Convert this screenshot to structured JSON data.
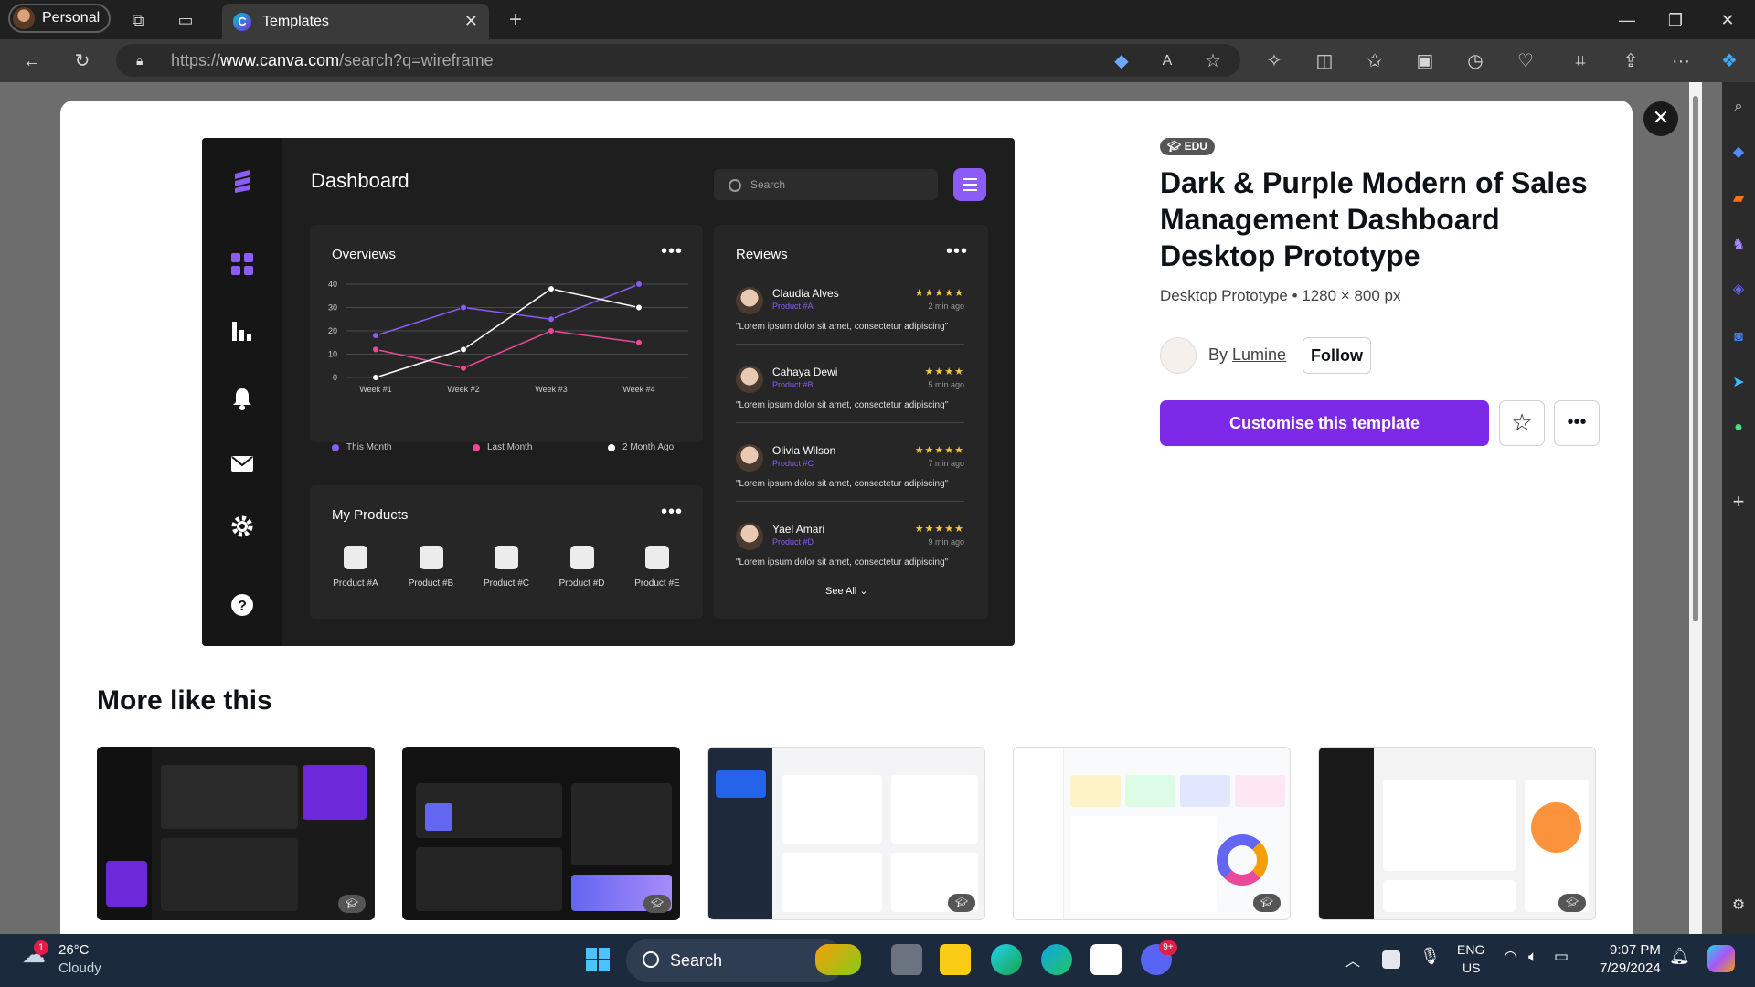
{
  "browser": {
    "profile_label": "Personal",
    "tab_title": "Templates",
    "url_prefix": "https://",
    "url_host": "www.canva.com",
    "url_path": "/search?q=wireframe"
  },
  "template": {
    "badge": "EDU",
    "title": "Dark & Purple Modern of Sales Management Dashboard Desktop Prototype",
    "subtitle": "Desktop Prototype • 1280 × 800 px",
    "by_prefix": "By",
    "creator": "Lumine",
    "follow_label": "Follow",
    "customise_label": "Customise this template",
    "more_heading": "More like this"
  },
  "preview": {
    "title": "Dashboard",
    "search_placeholder": "Search",
    "overviews": {
      "title": "Overviews",
      "legend": [
        "This Month",
        "Last Month",
        "2 Month Ago"
      ]
    },
    "reviews": {
      "title": "Reviews",
      "items": [
        {
          "name": "Claudia Alves",
          "product": "Product #A",
          "time": "2 min ago",
          "stars": "★★★★★",
          "text": "\"Lorem ipsum dolor sit amet, consectetur adipiscing\""
        },
        {
          "name": "Cahaya Dewi",
          "product": "Product #B",
          "time": "5 min ago",
          "stars": "★★★★",
          "text": "\"Lorem ipsum dolor sit amet, consectetur adipiscing\""
        },
        {
          "name": "Olivia Wilson",
          "product": "Product #C",
          "time": "7 min ago",
          "stars": "★★★★★",
          "text": "\"Lorem ipsum dolor sit amet, consectetur adipiscing\""
        },
        {
          "name": "Yael Amari",
          "product": "Product #D",
          "time": "9 min ago",
          "stars": "★★★★★",
          "text": "\"Lorem ipsum dolor sit amet, consectetur adipiscing\""
        }
      ],
      "see_all": "See All"
    },
    "products": {
      "title": "My Products",
      "items": [
        "Product #A",
        "Product #B",
        "Product #C",
        "Product #D",
        "Product #E"
      ]
    }
  },
  "chart_data": {
    "type": "line",
    "categories": [
      "Week #1",
      "Week #2",
      "Week #3",
      "Week #4"
    ],
    "series": [
      {
        "name": "This Month",
        "color": "#8b5cf6",
        "values": [
          18,
          30,
          25,
          40
        ]
      },
      {
        "name": "Last Month",
        "color": "#ec4899",
        "values": [
          12,
          4,
          20,
          15
        ]
      },
      {
        "name": "2 Month Ago",
        "color": "#ffffff",
        "values": [
          0,
          12,
          38,
          30
        ]
      }
    ],
    "yticks": [
      0,
      10,
      20,
      30,
      40
    ],
    "ylim": [
      0,
      40
    ]
  },
  "taskbar": {
    "weather_temp": "26°C",
    "weather_desc": "Cloudy",
    "weather_badge": "1",
    "search_label": "Search",
    "lang_1": "ENG",
    "lang_2": "US",
    "time": "9:07 PM",
    "date": "7/29/2024",
    "discord_badge": "9+"
  },
  "colors": {
    "accent": "#7d2ae8",
    "purple": "#8b5cf6",
    "pink": "#ec4899"
  }
}
